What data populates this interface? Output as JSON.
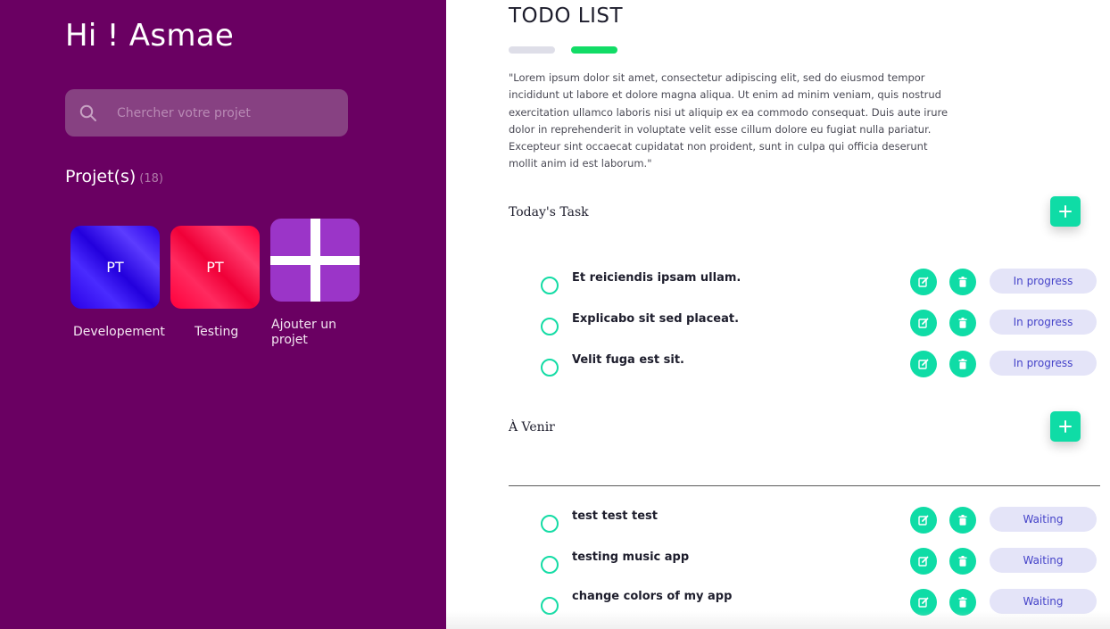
{
  "sidebar": {
    "greeting": "Hi ! Asmae",
    "search": {
      "placeholder": "Chercher votre projet",
      "icon": "search-icon"
    },
    "projects": {
      "heading": "Projet(s)",
      "count": "(18)",
      "items": [
        {
          "initials": "PT",
          "label": "Developement",
          "color": "#2a00e8"
        },
        {
          "initials": "PT",
          "label": "Testing",
          "color": "#ff003c"
        }
      ],
      "add": {
        "label": "Ajouter un projet",
        "icon": "plus-icon",
        "color": "#9b35c8"
      }
    }
  },
  "main": {
    "title": "TODO LIST",
    "description": "\"Lorem ipsum dolor sit amet, consectetur adipiscing elit, sed do eiusmod tempor incididunt ut labore et dolore magna aliqua. Ut enim ad minim veniam, quis nostrud exercitation ullamco laboris nisi ut aliquip ex ea commodo consequat. Duis aute irure dolor in reprehenderit in voluptate velit esse cillum dolore eu fugiat nulla pariatur. Excepteur sint occaecat cupidatat non proident, sunt in culpa qui officia deserunt mollit anim id est laborum.\"",
    "sections": [
      {
        "title": "Today's Task",
        "tasks": [
          {
            "text": "Et reiciendis ipsam ullam.",
            "status": "In progress"
          },
          {
            "text": "Explicabo sit sed placeat.",
            "status": "In progress"
          },
          {
            "text": "Velit fuga est sit.",
            "status": "In progress"
          }
        ]
      },
      {
        "title": "À Venir",
        "tasks": [
          {
            "text": "test test test",
            "status": "Waiting"
          },
          {
            "text": "testing music app",
            "status": "Waiting"
          },
          {
            "text": "change colors of my app",
            "status": "Waiting"
          }
        ]
      }
    ]
  },
  "colors": {
    "sidebar_bg": "#6a0062",
    "accent_green": "#0fdca6",
    "status_bg": "#e4e4f8",
    "status_text": "#4543c9",
    "pill_inactive": "#dedee8",
    "pill_active": "#12dc66"
  },
  "icons": {
    "edit": "edit-icon",
    "delete": "trash-icon",
    "add": "plus-icon",
    "check": "circle-check-icon"
  }
}
